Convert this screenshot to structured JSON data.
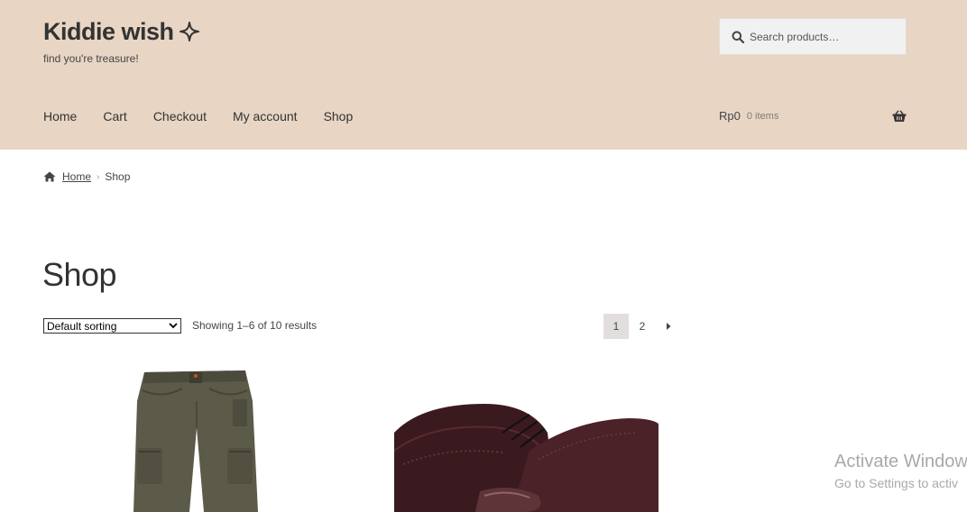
{
  "site": {
    "title": "Kiddie wish",
    "tagline": "find you're treasure!"
  },
  "search": {
    "placeholder": "Search products…"
  },
  "nav": {
    "items": [
      "Home",
      "Cart",
      "Checkout",
      "My account",
      "Shop"
    ]
  },
  "cart": {
    "amount": "Rp0",
    "count": "0 items"
  },
  "breadcrumb": {
    "home": "Home",
    "current": "Shop"
  },
  "page": {
    "title": "Shop"
  },
  "toolbar": {
    "sorting_selected": "Default sorting",
    "result_count": "Showing 1–6 of 10 results"
  },
  "pagination": {
    "pages": [
      "1",
      "2"
    ],
    "current": "1"
  },
  "watermark": {
    "title": "Activate Window",
    "subtitle": "Go to Settings to activ"
  },
  "colors": {
    "header_bg": "#e8d5c3",
    "text": "#43454b",
    "title": "#333333"
  },
  "icons": {
    "search": "search-icon",
    "basket": "basket-icon",
    "home": "home-icon",
    "sparkle": "sparkle-icon",
    "next": "chevron-right-icon"
  }
}
